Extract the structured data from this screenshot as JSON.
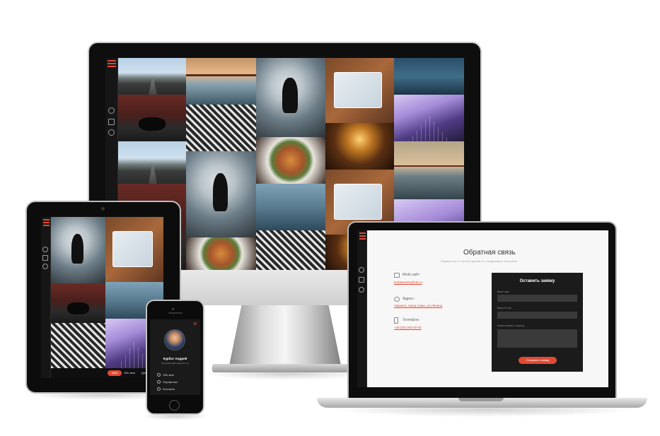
{
  "laptop": {
    "title": "Обратная связь",
    "subtitle": "Свяжитесь со мной одним из следующих способов",
    "contacts": [
      {
        "icon": "browser-icon",
        "label": "Мой сайт:",
        "value": "kurbatandrej@ub.ru"
      },
      {
        "icon": "sitemap-icon",
        "label": "Адрес:",
        "value": "Украина, город Сумы, ул.Ленина"
      },
      {
        "icon": "phone-icon",
        "label": "Телефон:",
        "value": "+38 (00) 000-00-00"
      }
    ],
    "form": {
      "title": "Оставить заявку",
      "name_label": "Ваше имя",
      "email_label": "Ваше Е-mail",
      "comment_label": "Комментарий к запросу",
      "submit_label": "Отправить заявку"
    }
  },
  "tablet": {
    "nav": [
      "Мой",
      "Обо мне",
      "Дни"
    ]
  },
  "phone": {
    "name": "Курбат Андрей",
    "role": "Фотограф, Веб-разработчик",
    "menu": [
      "Обо мне",
      "Портфолио",
      "Контакты"
    ]
  },
  "colors": {
    "accent": "#e24a34",
    "dark": "#161616"
  }
}
